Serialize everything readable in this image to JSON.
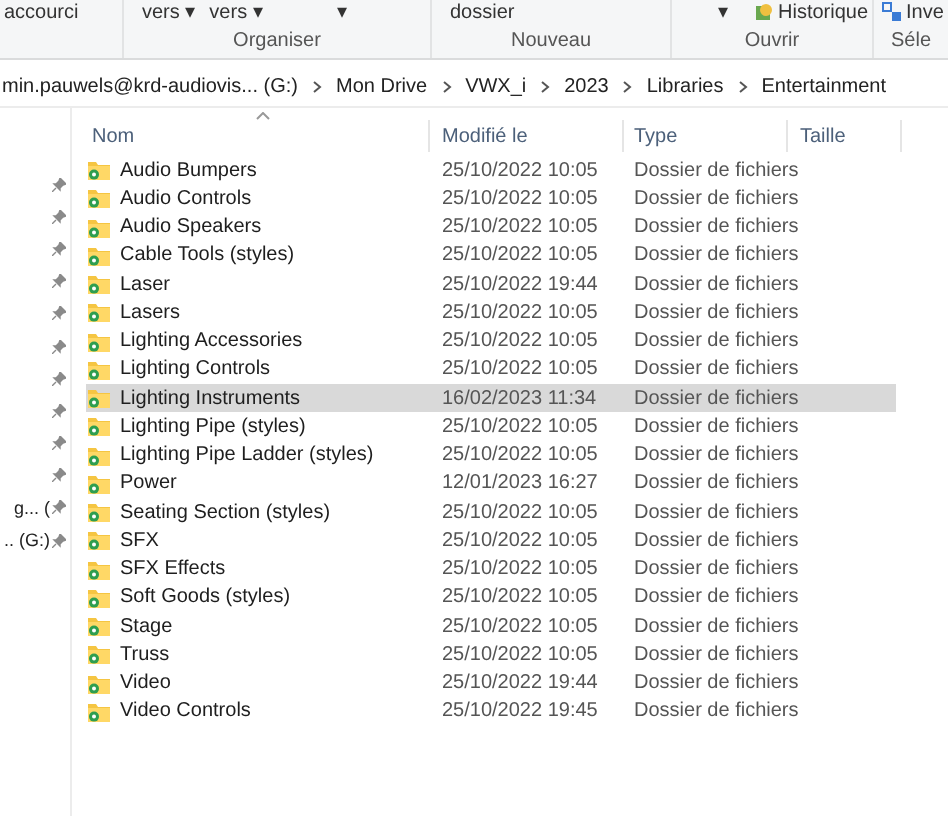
{
  "ribbon": {
    "groups": [
      {
        "controls": [
          "accourci"
        ]
      },
      {
        "label": "Organiser",
        "controls": [
          "vers ▾",
          "vers ▾",
          "▾"
        ]
      },
      {
        "label": "Nouveau",
        "controls": [
          "dossier"
        ]
      },
      {
        "label": "Ouvrir",
        "controls": [
          "▾",
          "Historique"
        ]
      },
      {
        "label": "Séle",
        "controls": [
          "Inve"
        ]
      }
    ]
  },
  "breadcrumb": [
    "min.pauwels@krd-audiovis... (G:)",
    "Mon Drive",
    "VWX_i",
    "2023",
    "Libraries",
    "Entertainment"
  ],
  "nav": [
    {
      "pinned": true
    },
    {
      "pinned": true
    },
    {
      "pinned": true
    },
    {
      "pinned": true
    },
    {
      "pinned": true
    },
    {
      "pinned": true
    },
    {
      "pinned": true
    },
    {
      "pinned": true
    },
    {
      "pinned": true
    },
    {
      "pinned": true
    },
    {
      "label": "g... (",
      "pinned": true
    },
    {
      "label": ".. (G:)",
      "pinned": true
    }
  ],
  "table": {
    "columns": [
      "Nom",
      "Modifié le",
      "Type",
      "Taille"
    ],
    "sort_ascending": true,
    "rows": [
      {
        "name": "Audio Bumpers",
        "modified": "25/10/2022 10:05",
        "type": "Dossier de fichiers",
        "selected": false
      },
      {
        "name": "Audio Controls",
        "modified": "25/10/2022 10:05",
        "type": "Dossier de fichiers",
        "selected": false
      },
      {
        "name": "Audio Speakers",
        "modified": "25/10/2022 10:05",
        "type": "Dossier de fichiers",
        "selected": false
      },
      {
        "name": "Cable Tools (styles)",
        "modified": "25/10/2022 10:05",
        "type": "Dossier de fichiers",
        "selected": false
      },
      {
        "name": "Laser",
        "modified": "25/10/2022 19:44",
        "type": "Dossier de fichiers",
        "selected": false
      },
      {
        "name": "Lasers",
        "modified": "25/10/2022 10:05",
        "type": "Dossier de fichiers",
        "selected": false
      },
      {
        "name": "Lighting Accessories",
        "modified": "25/10/2022 10:05",
        "type": "Dossier de fichiers",
        "selected": false
      },
      {
        "name": "Lighting Controls",
        "modified": "25/10/2022 10:05",
        "type": "Dossier de fichiers",
        "selected": false
      },
      {
        "name": "Lighting Instruments",
        "modified": "16/02/2023 11:34",
        "type": "Dossier de fichiers",
        "selected": true
      },
      {
        "name": "Lighting Pipe (styles)",
        "modified": "25/10/2022 10:05",
        "type": "Dossier de fichiers",
        "selected": false
      },
      {
        "name": "Lighting Pipe Ladder (styles)",
        "modified": "25/10/2022 10:05",
        "type": "Dossier de fichiers",
        "selected": false
      },
      {
        "name": "Power",
        "modified": "12/01/2023 16:27",
        "type": "Dossier de fichiers",
        "selected": false
      },
      {
        "name": "Seating Section (styles)",
        "modified": "25/10/2022 10:05",
        "type": "Dossier de fichiers",
        "selected": false
      },
      {
        "name": "SFX",
        "modified": "25/10/2022 10:05",
        "type": "Dossier de fichiers",
        "selected": false
      },
      {
        "name": "SFX Effects",
        "modified": "25/10/2022 10:05",
        "type": "Dossier de fichiers",
        "selected": false
      },
      {
        "name": "Soft Goods (styles)",
        "modified": "25/10/2022 10:05",
        "type": "Dossier de fichiers",
        "selected": false
      },
      {
        "name": "Stage",
        "modified": "25/10/2022 10:05",
        "type": "Dossier de fichiers",
        "selected": false
      },
      {
        "name": "Truss",
        "modified": "25/10/2022 10:05",
        "type": "Dossier de fichiers",
        "selected": false
      },
      {
        "name": "Video",
        "modified": "25/10/2022 19:44",
        "type": "Dossier de fichiers",
        "selected": false
      },
      {
        "name": "Video Controls",
        "modified": "25/10/2022 19:45",
        "type": "Dossier de fichiers",
        "selected": false
      }
    ]
  }
}
